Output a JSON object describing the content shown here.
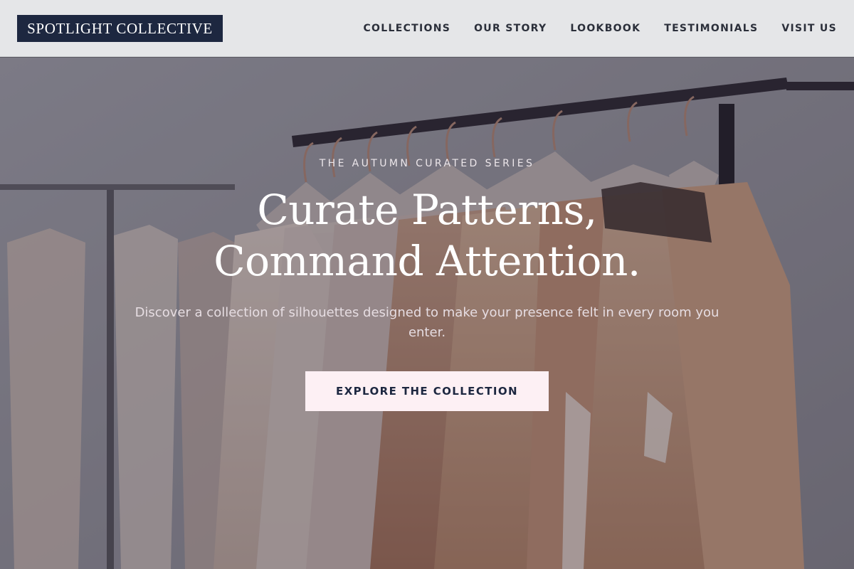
{
  "brand": {
    "name": "SPOTLIGHT COLLECTIVE"
  },
  "nav": {
    "items": [
      {
        "label": "COLLECTIONS"
      },
      {
        "label": "OUR STORY"
      },
      {
        "label": "LOOKBOOK"
      },
      {
        "label": "TESTIMONIALS"
      },
      {
        "label": "VISIT US"
      }
    ]
  },
  "hero": {
    "eyebrow": "THE AUTUMN CURATED SERIES",
    "headline_line1": "Curate Patterns,",
    "headline_line2": "Command Attention.",
    "subtext": "Discover a collection of silhouettes designed to make your presence felt in every room you enter.",
    "cta_label": "EXPLORE THE COLLECTION",
    "background": "clothing rack with dresses on hangers"
  },
  "colors": {
    "brand_navy": "#1d2740",
    "header_bg": "#e5e6e8",
    "cta_bg": "#fdf0f4",
    "nav_text": "#2b2f3a"
  }
}
